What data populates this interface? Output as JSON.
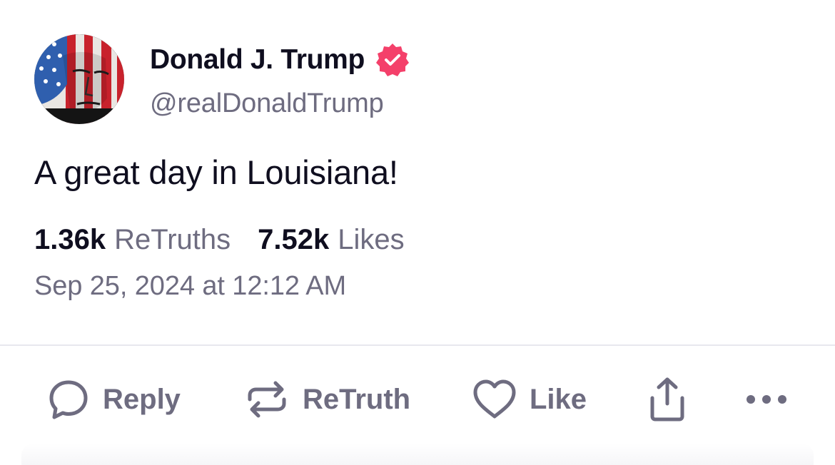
{
  "author": {
    "display_name": "Donald J. Trump",
    "handle": "@realDonaldTrump",
    "verified": true,
    "verified_badge_color": "#f4406a",
    "avatar_icon": "avatar-flag-portrait"
  },
  "post": {
    "text": "A great day in Louisiana!",
    "timestamp": "Sep 25, 2024 at 12:12 AM"
  },
  "stats": {
    "retruths_count": "1.36k",
    "retruths_label": "ReTruths",
    "likes_count": "7.52k",
    "likes_label": "Likes"
  },
  "actions": {
    "reply_label": "Reply",
    "retruth_label": "ReTruth",
    "like_label": "Like",
    "share_icon": "share-icon",
    "more_icon": "more-icon"
  },
  "colors": {
    "text_primary": "#0f0e1f",
    "text_secondary": "#6e6c80",
    "divider": "#e8e8ee"
  }
}
